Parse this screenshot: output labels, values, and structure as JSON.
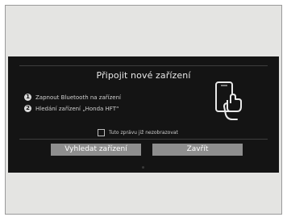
{
  "dialog": {
    "title": "Připojit nové zařízení",
    "steps": [
      {
        "number": "1",
        "text": "Zapnout Bluetooth na zařízení"
      },
      {
        "number": "2",
        "text": "Hledání zařízení „Honda HFT“"
      }
    ],
    "checkbox": {
      "label": "Tuto zprávu již nezobrazovat",
      "checked": false
    },
    "buttons": {
      "search": "Vyhledat zařízení",
      "close": "Zavřít"
    },
    "illustration_icon": "phone-touch-icon"
  },
  "colors": {
    "background": "#141414",
    "button": "#8e8e8e",
    "text": "#e8e8e8"
  }
}
